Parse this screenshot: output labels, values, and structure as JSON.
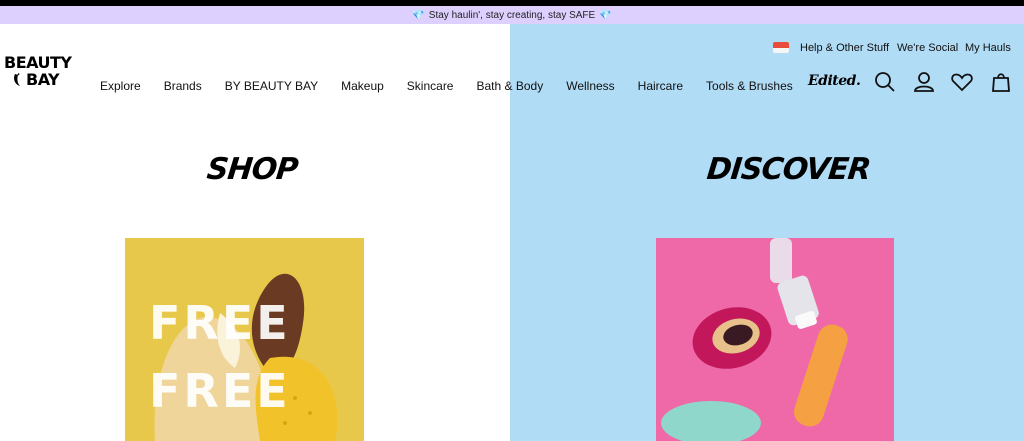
{
  "promo": {
    "text": "Stay haulin', stay creating, stay SAFE",
    "gem_left": "💎",
    "gem_right": "💎"
  },
  "logo": {
    "line1": "BEAUTY",
    "line2": "BAY"
  },
  "nav": {
    "items": [
      "Explore",
      "Brands",
      "BY BEAUTY BAY",
      "Makeup",
      "Skincare",
      "Bath & Body",
      "Wellness",
      "Haircare",
      "Tools & Brushes"
    ],
    "edited_label": "Edited."
  },
  "utility": {
    "help": "Help & Other Stuff",
    "social": "We're Social",
    "hauls": "My Hauls"
  },
  "icons": [
    "search-icon",
    "account-icon",
    "wishlist-icon",
    "bag-icon",
    "flag-icon",
    "banana-icon"
  ],
  "sections": {
    "shop": "SHOP",
    "discover": "DISCOVER"
  },
  "tiles": {
    "shop_line1": "FREE",
    "shop_line2": "FREE"
  },
  "colors": {
    "promo_bg": "#ddd0ff",
    "discover_bg": "#b1dcf5",
    "shop_tile": "#e8c84a",
    "discover_tile": "#ef69a8"
  }
}
